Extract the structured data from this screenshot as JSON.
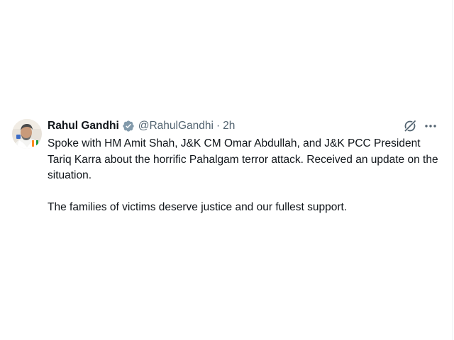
{
  "tweet": {
    "author_name": "Rahul Gandhi",
    "handle": "@RahulGandhi",
    "separator": "·",
    "time": "2h",
    "verified_icon": "verified-badge-icon",
    "more_icon": "more-options-icon",
    "grok_icon": "grok-icon",
    "paragraph1": "Spoke with HM Amit Shah, J&K CM Omar Abdullah, and J&K PCC President Tariq Karra about the horrific Pahalgam terror attack. Received an update on the situation.",
    "paragraph2": "The families of victims deserve justice and our fullest support."
  },
  "colors": {
    "text_primary": "#0f1419",
    "text_secondary": "#536471",
    "verified": "#829aab",
    "border": "#eff3f4"
  }
}
